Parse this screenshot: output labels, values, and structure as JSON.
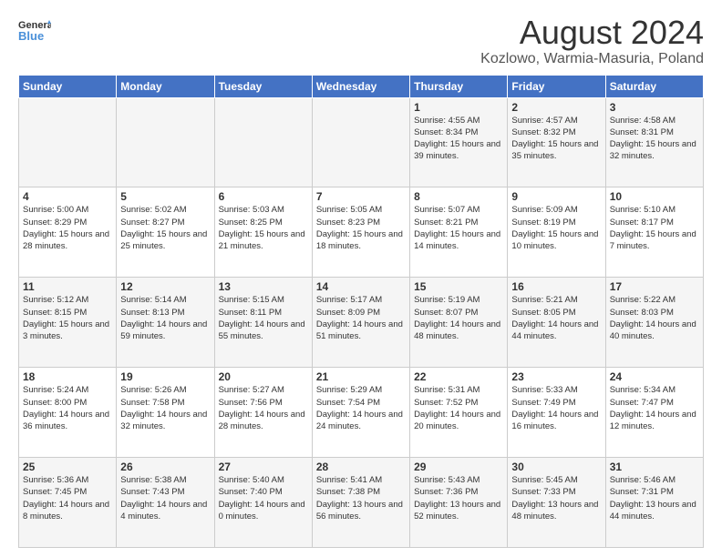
{
  "logo": {
    "general": "General",
    "blue": "Blue"
  },
  "title": "August 2024",
  "location": "Kozlowo, Warmia-Masuria, Poland",
  "headers": [
    "Sunday",
    "Monday",
    "Tuesday",
    "Wednesday",
    "Thursday",
    "Friday",
    "Saturday"
  ],
  "weeks": [
    [
      {
        "day": "",
        "info": ""
      },
      {
        "day": "",
        "info": ""
      },
      {
        "day": "",
        "info": ""
      },
      {
        "day": "",
        "info": ""
      },
      {
        "day": "1",
        "sunrise": "4:55 AM",
        "sunset": "8:34 PM",
        "daylight": "15 hours and 39 minutes."
      },
      {
        "day": "2",
        "sunrise": "4:57 AM",
        "sunset": "8:32 PM",
        "daylight": "15 hours and 35 minutes."
      },
      {
        "day": "3",
        "sunrise": "4:58 AM",
        "sunset": "8:31 PM",
        "daylight": "15 hours and 32 minutes."
      }
    ],
    [
      {
        "day": "4",
        "sunrise": "5:00 AM",
        "sunset": "8:29 PM",
        "daylight": "15 hours and 28 minutes."
      },
      {
        "day": "5",
        "sunrise": "5:02 AM",
        "sunset": "8:27 PM",
        "daylight": "15 hours and 25 minutes."
      },
      {
        "day": "6",
        "sunrise": "5:03 AM",
        "sunset": "8:25 PM",
        "daylight": "15 hours and 21 minutes."
      },
      {
        "day": "7",
        "sunrise": "5:05 AM",
        "sunset": "8:23 PM",
        "daylight": "15 hours and 18 minutes."
      },
      {
        "day": "8",
        "sunrise": "5:07 AM",
        "sunset": "8:21 PM",
        "daylight": "15 hours and 14 minutes."
      },
      {
        "day": "9",
        "sunrise": "5:09 AM",
        "sunset": "8:19 PM",
        "daylight": "15 hours and 10 minutes."
      },
      {
        "day": "10",
        "sunrise": "5:10 AM",
        "sunset": "8:17 PM",
        "daylight": "15 hours and 7 minutes."
      }
    ],
    [
      {
        "day": "11",
        "sunrise": "5:12 AM",
        "sunset": "8:15 PM",
        "daylight": "15 hours and 3 minutes."
      },
      {
        "day": "12",
        "sunrise": "5:14 AM",
        "sunset": "8:13 PM",
        "daylight": "14 hours and 59 minutes."
      },
      {
        "day": "13",
        "sunrise": "5:15 AM",
        "sunset": "8:11 PM",
        "daylight": "14 hours and 55 minutes."
      },
      {
        "day": "14",
        "sunrise": "5:17 AM",
        "sunset": "8:09 PM",
        "daylight": "14 hours and 51 minutes."
      },
      {
        "day": "15",
        "sunrise": "5:19 AM",
        "sunset": "8:07 PM",
        "daylight": "14 hours and 48 minutes."
      },
      {
        "day": "16",
        "sunrise": "5:21 AM",
        "sunset": "8:05 PM",
        "daylight": "14 hours and 44 minutes."
      },
      {
        "day": "17",
        "sunrise": "5:22 AM",
        "sunset": "8:03 PM",
        "daylight": "14 hours and 40 minutes."
      }
    ],
    [
      {
        "day": "18",
        "sunrise": "5:24 AM",
        "sunset": "8:00 PM",
        "daylight": "14 hours and 36 minutes."
      },
      {
        "day": "19",
        "sunrise": "5:26 AM",
        "sunset": "7:58 PM",
        "daylight": "14 hours and 32 minutes."
      },
      {
        "day": "20",
        "sunrise": "5:27 AM",
        "sunset": "7:56 PM",
        "daylight": "14 hours and 28 minutes."
      },
      {
        "day": "21",
        "sunrise": "5:29 AM",
        "sunset": "7:54 PM",
        "daylight": "14 hours and 24 minutes."
      },
      {
        "day": "22",
        "sunrise": "5:31 AM",
        "sunset": "7:52 PM",
        "daylight": "14 hours and 20 minutes."
      },
      {
        "day": "23",
        "sunrise": "5:33 AM",
        "sunset": "7:49 PM",
        "daylight": "14 hours and 16 minutes."
      },
      {
        "day": "24",
        "sunrise": "5:34 AM",
        "sunset": "7:47 PM",
        "daylight": "14 hours and 12 minutes."
      }
    ],
    [
      {
        "day": "25",
        "sunrise": "5:36 AM",
        "sunset": "7:45 PM",
        "daylight": "14 hours and 8 minutes."
      },
      {
        "day": "26",
        "sunrise": "5:38 AM",
        "sunset": "7:43 PM",
        "daylight": "14 hours and 4 minutes."
      },
      {
        "day": "27",
        "sunrise": "5:40 AM",
        "sunset": "7:40 PM",
        "daylight": "14 hours and 0 minutes."
      },
      {
        "day": "28",
        "sunrise": "5:41 AM",
        "sunset": "7:38 PM",
        "daylight": "13 hours and 56 minutes."
      },
      {
        "day": "29",
        "sunrise": "5:43 AM",
        "sunset": "7:36 PM",
        "daylight": "13 hours and 52 minutes."
      },
      {
        "day": "30",
        "sunrise": "5:45 AM",
        "sunset": "7:33 PM",
        "daylight": "13 hours and 48 minutes."
      },
      {
        "day": "31",
        "sunrise": "5:46 AM",
        "sunset": "7:31 PM",
        "daylight": "13 hours and 44 minutes."
      }
    ]
  ]
}
